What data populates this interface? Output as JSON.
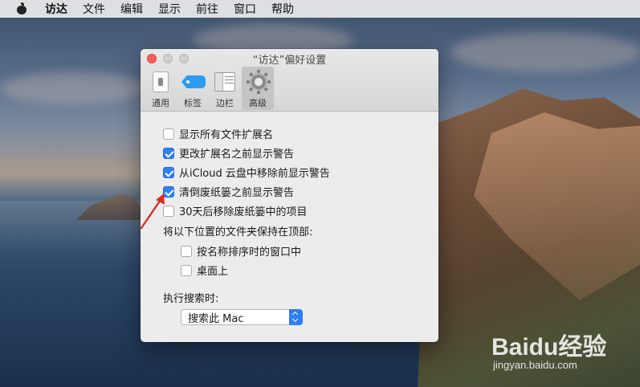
{
  "menubar": {
    "apple_icon": "apple-logo-icon",
    "app_name": "访达",
    "items": [
      "文件",
      "编辑",
      "显示",
      "前往",
      "窗口",
      "帮助"
    ]
  },
  "window": {
    "title": "“访达”偏好设置",
    "tabs": [
      {
        "label": "通用",
        "icon": "general-switch-icon",
        "active": false
      },
      {
        "label": "标签",
        "icon": "tag-icon",
        "active": false
      },
      {
        "label": "边栏",
        "icon": "sidebar-icon",
        "active": false
      },
      {
        "label": "高级",
        "icon": "gear-icon",
        "active": true
      }
    ],
    "options": [
      {
        "label": "显示所有文件扩展名",
        "checked": false
      },
      {
        "label": "更改扩展名之前显示警告",
        "checked": true
      },
      {
        "label": "从iCloud 云盘中移除前显示警告",
        "checked": true
      },
      {
        "label": "清倒废纸篓之前显示警告",
        "checked": true
      },
      {
        "label": "30天后移除废纸篓中的项目",
        "checked": false
      }
    ],
    "folders_heading": "将以下位置的文件夹保持在顶部:",
    "folder_options": [
      {
        "label": "按名称排序时的窗口中",
        "checked": false
      },
      {
        "label": "桌面上",
        "checked": false
      }
    ],
    "search_heading": "执行搜索时:",
    "search_select_value": "搜索此 Mac"
  },
  "colors": {
    "accent": "#2f7ff5",
    "close_light": "#fc5f57",
    "annotation_arrow": "#e02b24"
  },
  "watermark": {
    "brand": "Baidu经验",
    "url": "jingyan.baidu.com"
  }
}
